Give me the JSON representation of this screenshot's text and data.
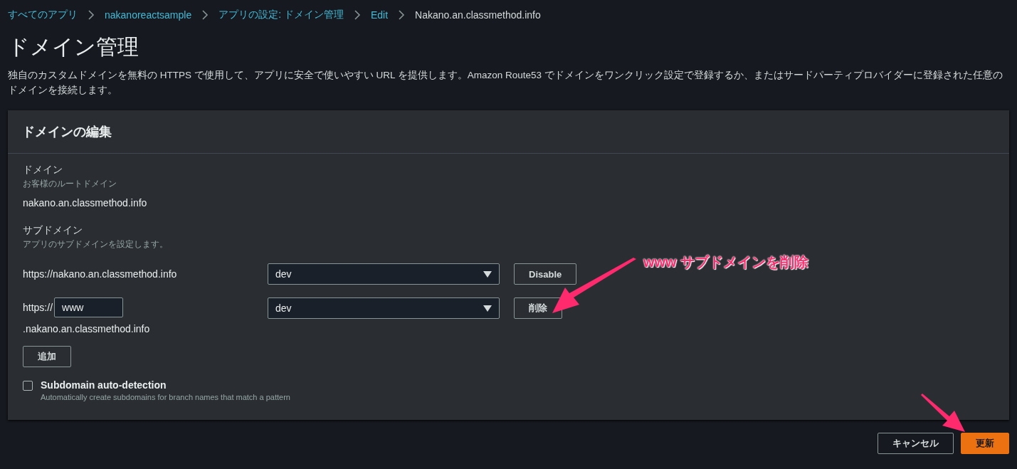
{
  "breadcrumbs": [
    {
      "label": "すべてのアプリ",
      "link": true
    },
    {
      "label": "nakanoreactsample",
      "link": true
    },
    {
      "label": "アプリの設定: ドメイン管理",
      "link": true
    },
    {
      "label": "Edit",
      "link": true
    },
    {
      "label": "Nakano.an.classmethod.info",
      "link": false
    }
  ],
  "title": "ドメイン管理",
  "description": "独自のカスタムドメインを無料の HTTPS で使用して、アプリに安全で使いやすい URL を提供します。Amazon Route53 でドメインをワンクリック設定で登録するか、またはサードパーティプロバイダーに登録された任意のドメインを接続します。",
  "panel": {
    "title": "ドメインの編集",
    "domain": {
      "label": "ドメイン",
      "hint": "お客様のルートドメイン",
      "value": "nakano.an.classmethod.info"
    },
    "subdomain": {
      "label": "サブドメイン",
      "hint": "アプリのサブドメインを設定します。"
    },
    "rows": [
      {
        "kind": "root",
        "url": "https://nakano.an.classmethod.info",
        "branch": "dev",
        "button": "Disable"
      },
      {
        "kind": "custom",
        "prefix": "https://",
        "value": "www",
        "suffix": ".nakano.an.classmethod.info",
        "branch": "dev",
        "button": "削除"
      }
    ],
    "add_button": "追加",
    "auto_detection": {
      "label": "Subdomain auto-detection",
      "hint": "Automatically create subdomains for branch names that match a pattern",
      "checked": false
    }
  },
  "actions": [
    {
      "label": "キャンセル",
      "kind": "secondary"
    },
    {
      "label": "更新",
      "kind": "primary"
    }
  ],
  "annotation": {
    "text": "www サブドメインを削除"
  }
}
